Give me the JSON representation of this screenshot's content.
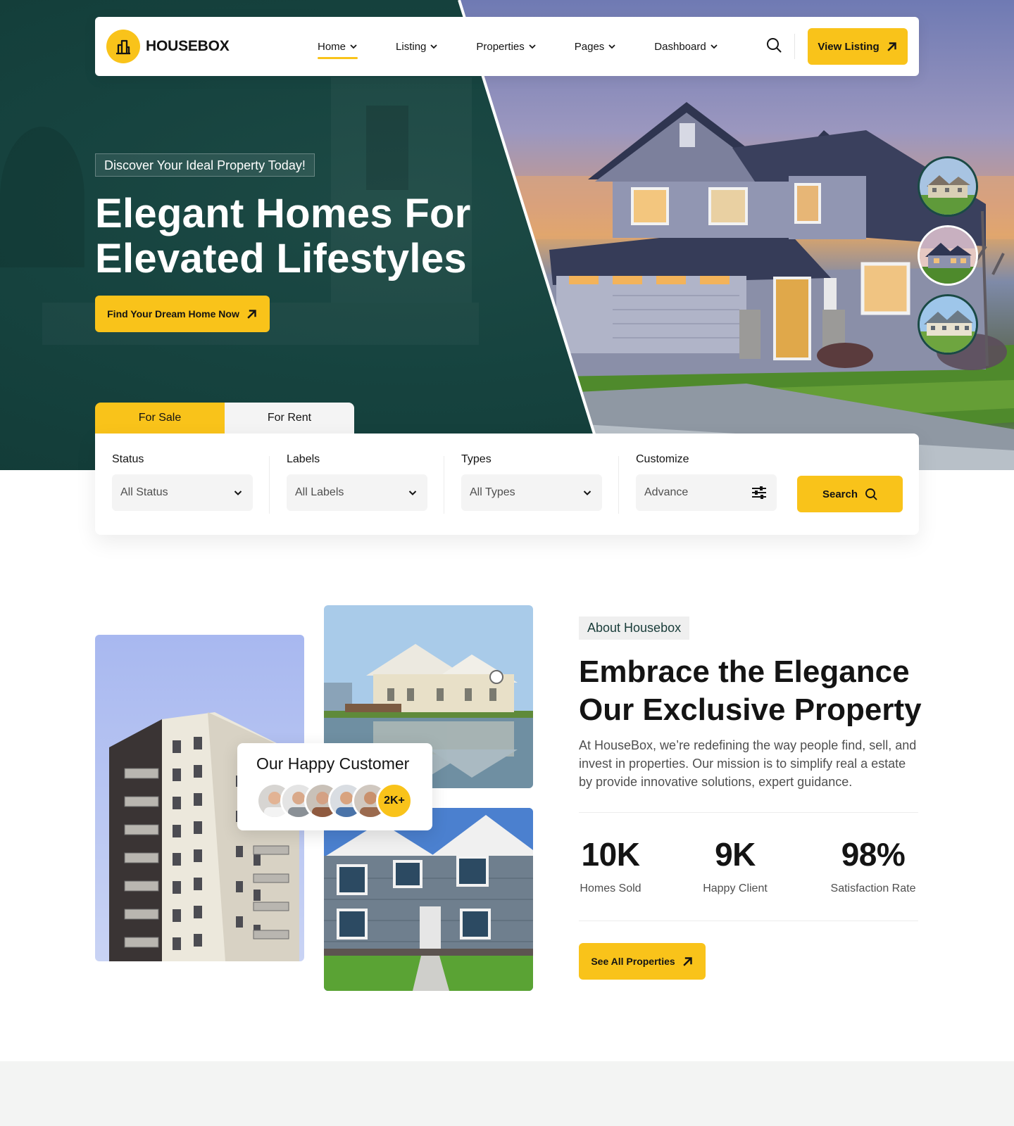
{
  "brand": {
    "name": "HOUSEBOX",
    "accent": "#f9c31a",
    "dark_green": "#1a3d3a"
  },
  "nav": {
    "items": [
      {
        "label": "Home",
        "active": true
      },
      {
        "label": "Listing",
        "active": false
      },
      {
        "label": "Properties",
        "active": false
      },
      {
        "label": "Pages",
        "active": false
      },
      {
        "label": "Dashboard",
        "active": false
      }
    ],
    "search_icon": "search-icon",
    "cta_label": "View Listing",
    "cta_icon": "arrow-up-right-icon"
  },
  "hero": {
    "tag": "Discover Your Ideal Property Today!",
    "title_line1": "Elegant Homes For",
    "title_line2": "Elevated Lifestyles",
    "cta_label": "Find Your Dream Home Now",
    "thumbnails": [
      "house-thumbnail-1",
      "house-thumbnail-2",
      "house-thumbnail-3"
    ]
  },
  "search": {
    "tabs": [
      {
        "label": "For Sale",
        "active": true
      },
      {
        "label": "For Rent",
        "active": false
      }
    ],
    "fields": [
      {
        "label": "Status",
        "value": "All Status",
        "icon": "chevron-down-icon"
      },
      {
        "label": "Labels",
        "value": "All Labels",
        "icon": "chevron-down-icon"
      },
      {
        "label": "Types",
        "value": "All Types",
        "icon": "chevron-down-icon"
      },
      {
        "label": "Customize",
        "value": "Advance",
        "icon": "sliders-icon"
      }
    ],
    "button_label": "Search"
  },
  "about": {
    "tag": "About Housebox",
    "title_line1": "Embrace the Elegance",
    "title_line2": "Our Exclusive Property",
    "description": "At HouseBox, we’re redefining the way people find, sell, and invest in properties. Our mission is to simplify real a estate by provide innovative solutions, expert guidance.",
    "customer_card": {
      "title": "Our Happy Customer",
      "count": "2K+"
    },
    "stats": [
      {
        "value": "10K",
        "label": "Homes Sold"
      },
      {
        "value": "9K",
        "label": "Happy Client"
      },
      {
        "value": "98%",
        "label": "Satisfaction Rate"
      }
    ],
    "cta_label": "See All Properties"
  }
}
